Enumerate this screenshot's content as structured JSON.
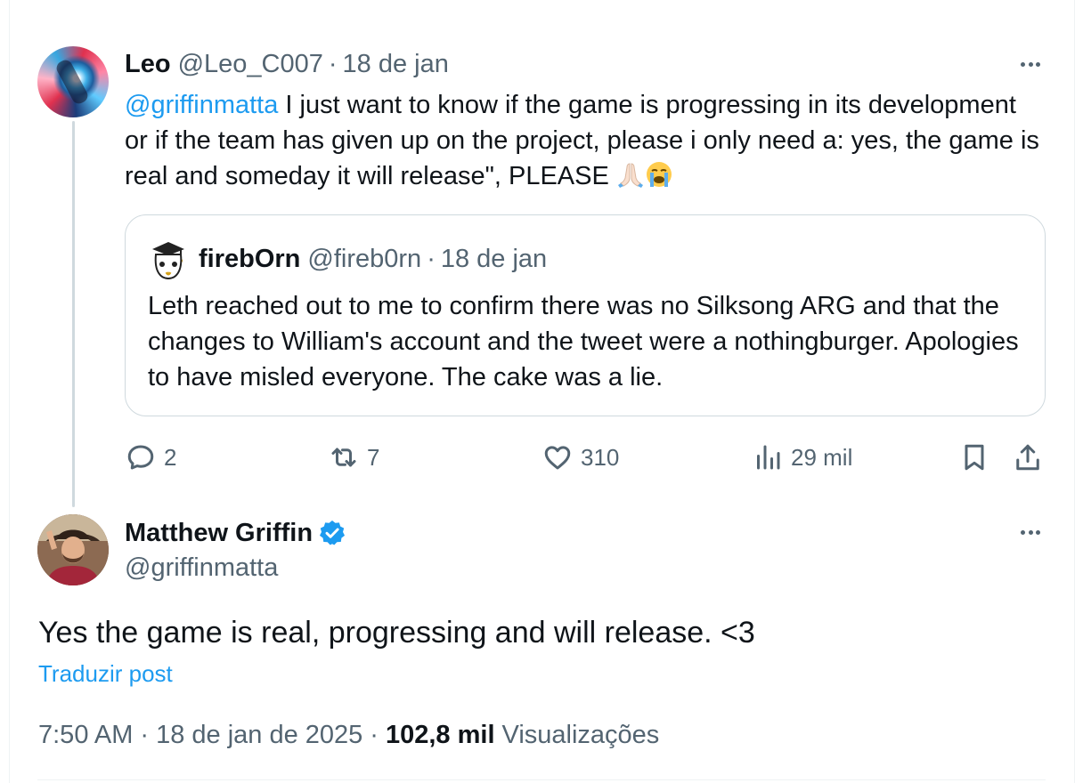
{
  "reply": {
    "author_name": "Leo",
    "author_handle": "@Leo_C007",
    "separator": "·",
    "time": "18 de jan",
    "mention": "@griffinmatta",
    "body": " I just want to know if the game is progressing in its development or if the team has given up on the project, please i only need a: yes, the game is real and someday it will release\", PLEASE ",
    "emojis": [
      "folded-hands-icon",
      "loudly-crying-face-icon"
    ],
    "quote": {
      "author_name": "firebOrn",
      "author_handle": "@fireb0rn",
      "time": "18 de jan",
      "body": "Leth reached out to me to confirm there was no Silksong ARG and that the changes to William's account and the tweet were a nothingburger. Apologies to have misled everyone. The cake was a lie."
    },
    "actions": {
      "replies": "2",
      "reposts": "7",
      "likes": "310",
      "views": "29 mil"
    }
  },
  "post": {
    "author_name": "Matthew Griffin",
    "author_handle": "@griffinmatta",
    "verified": true,
    "text": "Yes the game is real, progressing and will release. <3",
    "translate_label": "Traduzir post",
    "time": "7:50 AM",
    "date": "18 de jan de 2025",
    "separator": "·",
    "views_count": "102,8 mil",
    "views_label": "Visualizações"
  },
  "colors": {
    "link": "#1d9bf0",
    "secondary_text": "#536471",
    "primary_text": "#0f1419",
    "border": "#cfd9de"
  }
}
